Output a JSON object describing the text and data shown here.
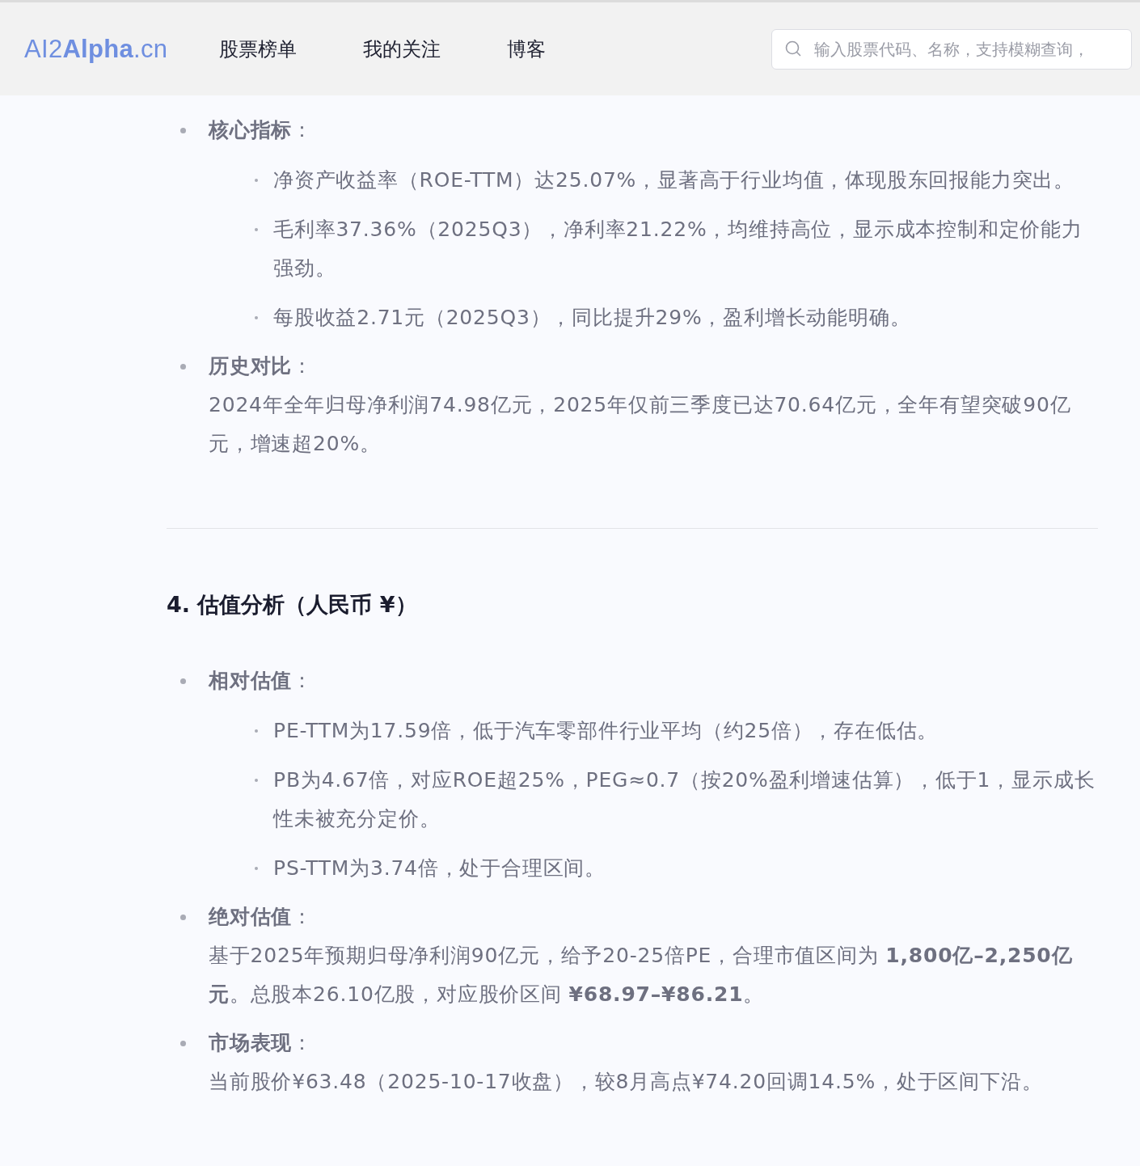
{
  "header": {
    "logo": "AI2**Alpha**.cn",
    "nav": [
      {
        "label": "股票榜单"
      },
      {
        "label": "我的关注"
      },
      {
        "label": "博客"
      }
    ],
    "search": {
      "placeholder": "输入股票代码、名称，支持模糊查询，"
    }
  },
  "blocks": [
    {
      "kind": "list",
      "items": [
        {
          "label": "**核心指标**：",
          "bullets": [
            "净资产收益率（ROE-TTM）达25.07%，显著高于行业均值，体现股东回报能力突出。",
            "毛利率37.36%（2025Q3），净利率21.22%，均维持高位，显示成本控制和定价能力强劲。",
            "每股收益2.71元（2025Q3），同比提升29%，盈利增长动能明确。"
          ]
        },
        {
          "label": "**历史对比**：",
          "text": "2024年全年归母净利润74.98亿元，2025年仅前三季度已达70.64亿元，全年有望突破90亿元，增速超20%。"
        }
      ]
    },
    {
      "kind": "divider"
    },
    {
      "kind": "heading",
      "text": "4. 估值分析（人民币 ¥）"
    },
    {
      "kind": "list",
      "items": [
        {
          "label": "**相对估值**：",
          "bullets": [
            "PE-TTM为17.59倍，低于汽车零部件行业平均（约25倍），存在低估。",
            "PB为4.67倍，对应ROE超25%，PEG≈0.7（按20%盈利增速估算），低于1，显示成长性未被充分定价。",
            "PS-TTM为3.74倍，处于合理区间。"
          ]
        },
        {
          "label": "**绝对估值**：",
          "text": "基于2025年预期归母净利润90亿元，给予20-25倍PE，合理市值区间为 **1,800亿–2,250亿元**。总股本26.10亿股，对应股价区间 **¥68.97–¥86.21**。"
        },
        {
          "label": "**市场表现**：",
          "text": "当前股价¥63.48（2025-10-17收盘），较8月高点¥74.20回调14.5%，处于区间下沿。"
        }
      ]
    }
  ]
}
